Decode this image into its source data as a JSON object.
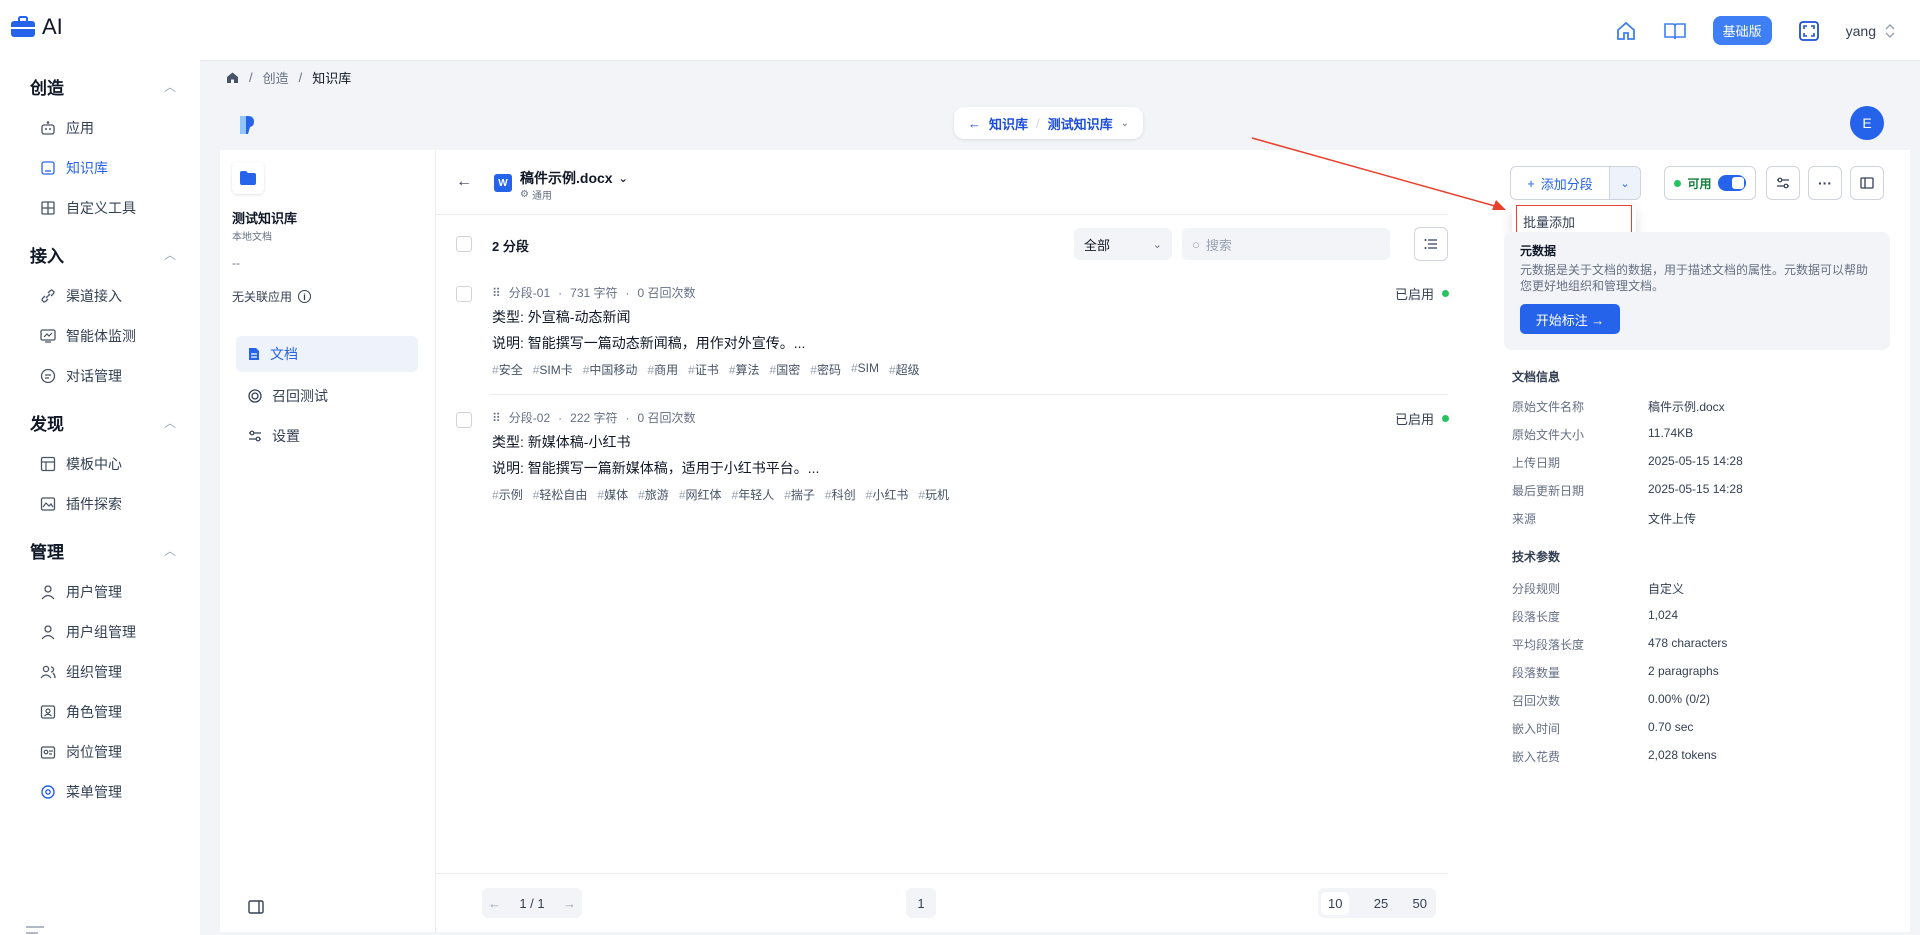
{
  "app": {
    "title": "AI"
  },
  "topbar": {
    "badge": "基础版",
    "user": "yang"
  },
  "sidebar": {
    "sections": [
      {
        "title": "创造",
        "items": [
          "应用",
          "知识库",
          "自定义工具"
        ]
      },
      {
        "title": "接入",
        "items": [
          "渠道接入",
          "智能体监测",
          "对话管理"
        ]
      },
      {
        "title": "发现",
        "items": [
          "模板中心",
          "插件探索"
        ]
      },
      {
        "title": "管理",
        "items": [
          "用户管理",
          "用户组管理",
          "组织管理",
          "角色管理",
          "岗位管理",
          "菜单管理"
        ]
      }
    ]
  },
  "breadcrumb": {
    "home": "",
    "b1": "创造",
    "b2": "知识库"
  },
  "kbar": {
    "back": "知识库",
    "current": "测试知识库",
    "avatar": "E"
  },
  "kb_panel": {
    "name": "测试知识库",
    "sub": "本地文档",
    "desc": "--",
    "assoc": "无关联应用",
    "menu": [
      "文档",
      "召回测试",
      "设置"
    ]
  },
  "doc": {
    "name": "稿件示例.docx",
    "mode": "通用",
    "add_label": "添加分段",
    "menu_item": "批量添加",
    "status": "可用",
    "count": "2 分段",
    "filter": "全部",
    "search_placeholder": "搜索",
    "segments": [
      {
        "id": "分段-01",
        "chars": "731 字符",
        "recall": "0 召回次数",
        "state": "已启用",
        "line1": "类型: 外宣稿-动态新闻",
        "line2": "说明: 智能撰写一篇动态新闻稿，用作对外宣传。...",
        "tags": [
          "安全",
          "SIM卡",
          "中国移动",
          "商用",
          "证书",
          "算法",
          "国密",
          "密码",
          "SIM",
          "超级"
        ]
      },
      {
        "id": "分段-02",
        "chars": "222 字符",
        "recall": "0 召回次数",
        "state": "已启用",
        "line1": "类型: 新媒体稿-小红书",
        "line2": "说明: 智能撰写一篇新媒体稿，适用于小红书平台。...",
        "tags": [
          "示例",
          "轻松自由",
          "媒体",
          "旅游",
          "网红体",
          "年轻人",
          "揣子",
          "科创",
          "小红书",
          "玩机"
        ]
      }
    ],
    "pager": {
      "pages": "1 / 1",
      "current": "1",
      "sizes": [
        "10",
        "25",
        "50"
      ]
    }
  },
  "info": {
    "meta_title": "元数据",
    "meta_desc": "元数据是关于文档的数据，用于描述文档的属性。元数据可以帮助您更好地组织和管理文档。",
    "meta_btn": "开始标注 →",
    "doc_title": "文档信息",
    "doc_rows": [
      [
        "原始文件名称",
        "稿件示例.docx"
      ],
      [
        "原始文件大小",
        "11.74KB"
      ],
      [
        "上传日期",
        "2025-05-15 14:28"
      ],
      [
        "最后更新日期",
        "2025-05-15 14:28"
      ],
      [
        "来源",
        "文件上传"
      ]
    ],
    "tech_title": "技术参数",
    "tech_rows": [
      [
        "分段规则",
        "自定义"
      ],
      [
        "段落长度",
        "1,024"
      ],
      [
        "平均段落长度",
        "478 characters"
      ],
      [
        "段落数量",
        "2 paragraphs"
      ],
      [
        "召回次数",
        "0.00% (0/2)"
      ],
      [
        "嵌入时间",
        "0.70 sec"
      ],
      [
        "嵌入花费",
        "2,028 tokens"
      ]
    ]
  },
  "colors": {
    "accent": "#2563eb",
    "enabled": "#22c55e",
    "annotation": "#e8402c"
  }
}
